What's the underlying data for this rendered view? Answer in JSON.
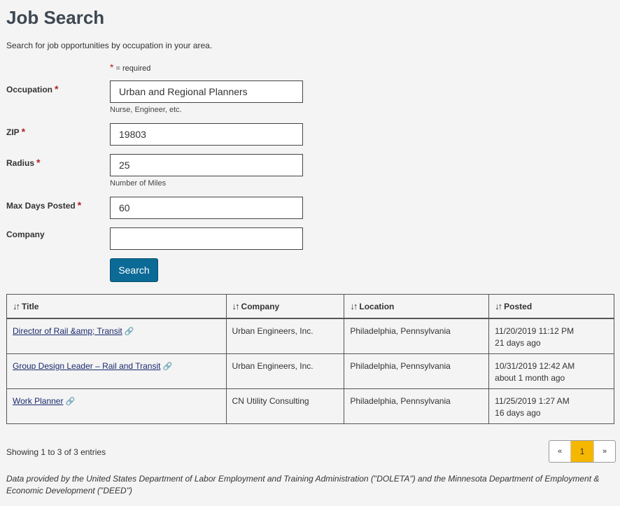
{
  "page": {
    "title": "Job Search",
    "subtitle": "Search for job opportunities by occupation in your area.",
    "required_star": "*",
    "required_note": "= required"
  },
  "form": {
    "occupation": {
      "label": "Occupation",
      "value": "Urban and Regional Planners",
      "hint": "Nurse, Engineer, etc."
    },
    "zip": {
      "label": "ZIP",
      "value": "19803"
    },
    "radius": {
      "label": "Radius",
      "value": "25",
      "hint": "Number of Miles"
    },
    "max_days": {
      "label": "Max Days Posted",
      "value": "60"
    },
    "company": {
      "label": "Company",
      "value": ""
    },
    "search_label": "Search"
  },
  "table": {
    "sort_icon": "↓↑",
    "columns": [
      "Title",
      "Company",
      "Location",
      "Posted"
    ],
    "rows": [
      {
        "title": "Director of Rail &amp; Transit",
        "company": "Urban Engineers, Inc.",
        "location": "Philadelphia, Pennsylvania",
        "posted_date": "11/20/2019 11:12 PM",
        "posted_ago": "21 days ago"
      },
      {
        "title": "Group Design Leader – Rail and Transit",
        "company": "Urban Engineers, Inc.",
        "location": "Philadelphia, Pennsylvania",
        "posted_date": "10/31/2019 12:42 AM",
        "posted_ago": "about 1 month ago"
      },
      {
        "title": "Work Planner",
        "company": "CN Utility Consulting",
        "location": "Philadelphia, Pennsylvania",
        "posted_date": "11/25/2019 1:27 AM",
        "posted_ago": "16 days ago"
      }
    ]
  },
  "pagination": {
    "showing": "Showing 1 to 3 of 3 entries",
    "prev": "«",
    "current": "1",
    "next": "»"
  },
  "footer": {
    "note": "Data provided by the United States Department of Labor Employment and Training Administration (\"DOLETA\") and the Minnesota Department of Employment & Economic Development (\"DEED\")"
  },
  "colors": {
    "accent": "#0b6a96",
    "required": "#b22222",
    "active_page": "#f5b700"
  },
  "icons": {
    "external_link": "link-icon",
    "sort": "sort-icon"
  }
}
